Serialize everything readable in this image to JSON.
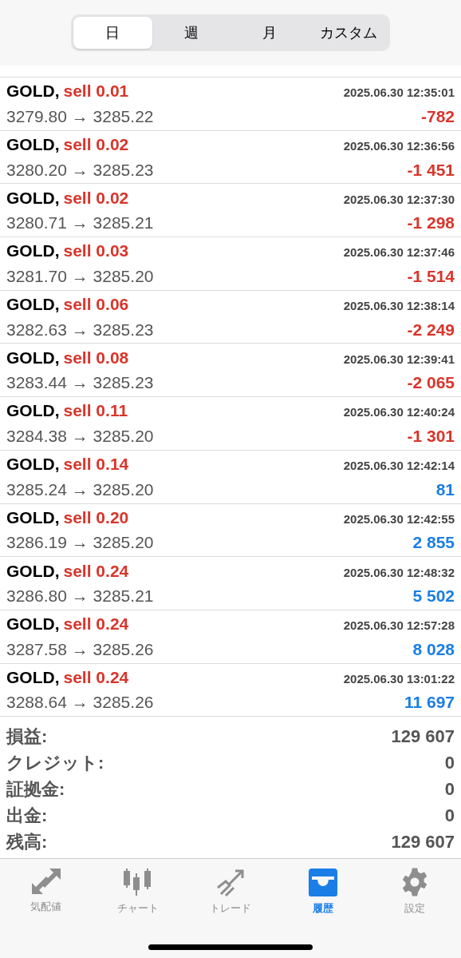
{
  "period_tabs": [
    {
      "label": "日",
      "selected": true
    },
    {
      "label": "週",
      "selected": false
    },
    {
      "label": "月",
      "selected": false
    },
    {
      "label": "カスタム",
      "selected": false
    }
  ],
  "deals": [
    {
      "symbol": "GOLD,",
      "order": "sell 0.01",
      "time": "2025.06.30 12:35:01",
      "prices": "3279.80 → 3285.22",
      "profit": "-782",
      "kind": "loss"
    },
    {
      "symbol": "GOLD,",
      "order": "sell 0.02",
      "time": "2025.06.30 12:36:56",
      "prices": "3280.20 → 3285.23",
      "profit": "-1 451",
      "kind": "loss"
    },
    {
      "symbol": "GOLD,",
      "order": "sell 0.02",
      "time": "2025.06.30 12:37:30",
      "prices": "3280.71 → 3285.21",
      "profit": "-1 298",
      "kind": "loss"
    },
    {
      "symbol": "GOLD,",
      "order": "sell 0.03",
      "time": "2025.06.30 12:37:46",
      "prices": "3281.70 → 3285.20",
      "profit": "-1 514",
      "kind": "loss"
    },
    {
      "symbol": "GOLD,",
      "order": "sell 0.06",
      "time": "2025.06.30 12:38:14",
      "prices": "3282.63 → 3285.23",
      "profit": "-2 249",
      "kind": "loss"
    },
    {
      "symbol": "GOLD,",
      "order": "sell 0.08",
      "time": "2025.06.30 12:39:41",
      "prices": "3283.44 → 3285.23",
      "profit": "-2 065",
      "kind": "loss"
    },
    {
      "symbol": "GOLD,",
      "order": "sell 0.11",
      "time": "2025.06.30 12:40:24",
      "prices": "3284.38 → 3285.20",
      "profit": "-1 301",
      "kind": "loss"
    },
    {
      "symbol": "GOLD,",
      "order": "sell 0.14",
      "time": "2025.06.30 12:42:14",
      "prices": "3285.24 → 3285.20",
      "profit": "81",
      "kind": "gain"
    },
    {
      "symbol": "GOLD,",
      "order": "sell 0.20",
      "time": "2025.06.30 12:42:55",
      "prices": "3286.19 → 3285.20",
      "profit": "2 855",
      "kind": "gain"
    },
    {
      "symbol": "GOLD,",
      "order": "sell 0.24",
      "time": "2025.06.30 12:48:32",
      "prices": "3286.80 → 3285.21",
      "profit": "5 502",
      "kind": "gain"
    },
    {
      "symbol": "GOLD,",
      "order": "sell 0.24",
      "time": "2025.06.30 12:57:28",
      "prices": "3287.58 → 3285.26",
      "profit": "8 028",
      "kind": "gain"
    },
    {
      "symbol": "GOLD,",
      "order": "sell 0.24",
      "time": "2025.06.30 13:01:22",
      "prices": "3288.64 → 3285.26",
      "profit": "11 697",
      "kind": "gain"
    }
  ],
  "summary": [
    {
      "label": "損益:",
      "value": "129 607"
    },
    {
      "label": "クレジット:",
      "value": "0"
    },
    {
      "label": "証拠金:",
      "value": "0"
    },
    {
      "label": "出金:",
      "value": "0"
    },
    {
      "label": "残高:",
      "value": "129 607"
    }
  ],
  "tab_bar": [
    {
      "label": "気配値",
      "kind": "quotes",
      "selected": false
    },
    {
      "label": "チャート",
      "kind": "chart",
      "selected": false
    },
    {
      "label": "トレード",
      "kind": "trade",
      "selected": false
    },
    {
      "label": "履歴",
      "kind": "history",
      "selected": true
    },
    {
      "label": "設定",
      "kind": "settings",
      "selected": false
    }
  ]
}
